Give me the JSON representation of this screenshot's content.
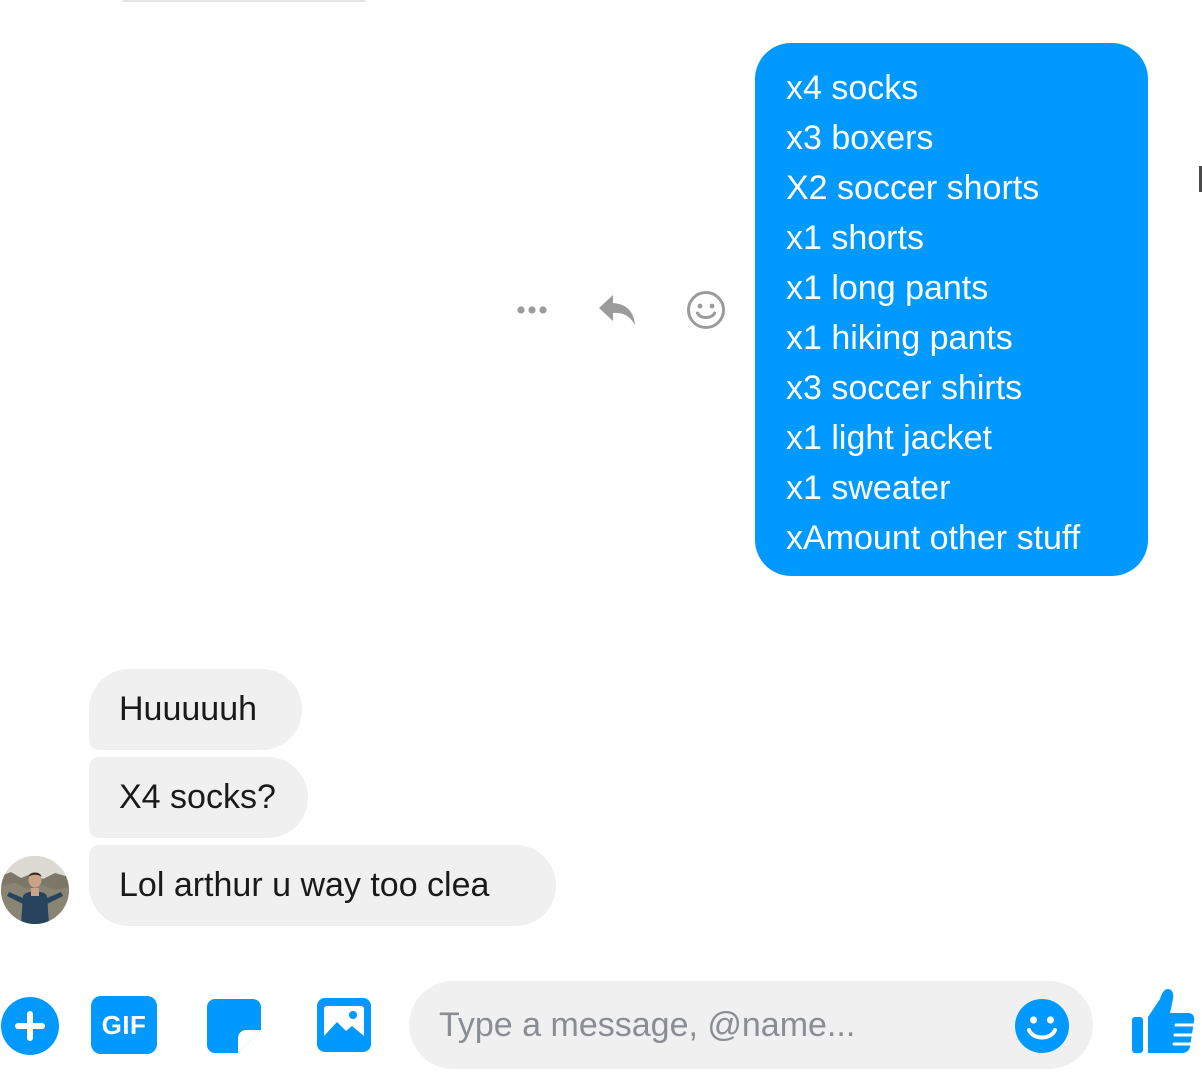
{
  "outgoing": {
    "lines": [
      "x4 socks",
      "x3 boxers",
      "X2 soccer shorts",
      "x1 shorts",
      "x1 long pants",
      "x1 hiking pants",
      "x3 soccer shirts",
      "x1 light jacket",
      "x1 sweater",
      "xAmount other stuff"
    ]
  },
  "message_actions": {
    "icons": [
      "more-options-icon",
      "reply-icon",
      "react-emoji-icon"
    ]
  },
  "incoming": {
    "messages": [
      "Huuuuuh",
      "X4 socks?",
      "Lol arthur u way too clea"
    ]
  },
  "composer": {
    "placeholder": "Type a message, @name...",
    "value": "",
    "gif_label": "GIF",
    "icons": [
      "add-icon",
      "gif-icon",
      "sticker-icon",
      "image-icon",
      "emoji-icon",
      "thumbs-up-icon"
    ]
  },
  "colors": {
    "accent": "#0099ff",
    "incoming_bubble": "#f1f0f0",
    "action_icon": "#9b9b9b"
  }
}
